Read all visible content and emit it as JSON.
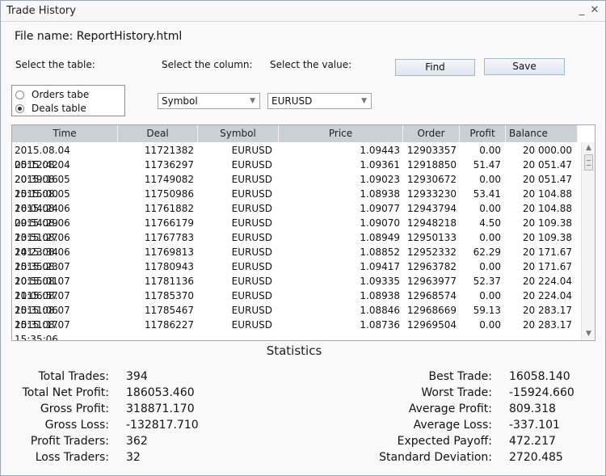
{
  "window": {
    "title": "Trade History"
  },
  "file": {
    "label": "File name: ReportHistory.html"
  },
  "labels": {
    "select_table": "Select the table:",
    "select_column": "Select the column:",
    "select_value": "Select the value:"
  },
  "buttons": {
    "find": "Find",
    "save": "Save"
  },
  "radio": {
    "orders": "Orders tabe",
    "deals": "Deals table",
    "selected": "deals"
  },
  "filters": {
    "column": "Symbol",
    "value": "EURUSD"
  },
  "table": {
    "headers": [
      "Time",
      "Deal",
      "Symbol",
      "Price",
      "Order",
      "Profit",
      "Balance"
    ],
    "rows": [
      [
        "2015.08.04 05:12:42",
        "11721382",
        "EURUSD",
        "1.09443",
        "12903357",
        "0.00",
        "20 000.00"
      ],
      [
        "2015.08.04 20:39:16",
        "11736297",
        "EURUSD",
        "1.09361",
        "12918850",
        "51.47",
        "20 051.47"
      ],
      [
        "2015.08.05 15:15:00",
        "11749082",
        "EURUSD",
        "1.09023",
        "12930672",
        "0.00",
        "20 051.47"
      ],
      [
        "2015.08.05 16:04:24",
        "11750986",
        "EURUSD",
        "1.08938",
        "12933230",
        "53.41",
        "20 104.88"
      ],
      [
        "2015.08.06 09:54:29",
        "11761882",
        "EURUSD",
        "1.09077",
        "12943794",
        "0.00",
        "20 104.88"
      ],
      [
        "2015.08.06 13:51:27",
        "11766179",
        "EURUSD",
        "1.09070",
        "12948218",
        "4.50",
        "20 109.38"
      ],
      [
        "2015.08.06 14:23:34",
        "11767783",
        "EURUSD",
        "1.08949",
        "12950133",
        "0.00",
        "20 109.38"
      ],
      [
        "2015.08.06 15:35:23",
        "11769813",
        "EURUSD",
        "1.08852",
        "12952332",
        "62.29",
        "20 171.67"
      ],
      [
        "2015.08.07 10:55:01",
        "11780943",
        "EURUSD",
        "1.09417",
        "12963782",
        "0.00",
        "20 171.67"
      ],
      [
        "2015.08.07 11:06:57",
        "11781136",
        "EURUSD",
        "1.09335",
        "12963977",
        "52.37",
        "20 224.04"
      ],
      [
        "2015.08.07 15:31:06",
        "11785370",
        "EURUSD",
        "1.08938",
        "12968574",
        "0.00",
        "20 224.04"
      ],
      [
        "2015.08.07 15:31:17",
        "11785467",
        "EURUSD",
        "1.08846",
        "12968669",
        "59.13",
        "20 283.17"
      ],
      [
        "2015.08.07 15:35:06",
        "11786227",
        "EURUSD",
        "1.08736",
        "12969504",
        "0.00",
        "20 283.17"
      ]
    ]
  },
  "statistics": {
    "title": "Statistics",
    "left": [
      {
        "label": "Total Trades:",
        "value": "394"
      },
      {
        "label": "Total Net Profit:",
        "value": "186053.460"
      },
      {
        "label": "Gross Profit:",
        "value": "318871.170"
      },
      {
        "label": "Gross Loss:",
        "value": "-132817.710"
      },
      {
        "label": "Profit Traders:",
        "value": "362"
      },
      {
        "label": "Loss Traders:",
        "value": "32"
      }
    ],
    "right": [
      {
        "label": "Best Trade:",
        "value": "16058.140"
      },
      {
        "label": "Worst Trade:",
        "value": "-15924.660"
      },
      {
        "label": "Average Profit:",
        "value": "809.318"
      },
      {
        "label": "Average Loss:",
        "value": "-337.101"
      },
      {
        "label": "Expected Payoff:",
        "value": "472.217"
      },
      {
        "label": "Standard Deviation:",
        "value": "2720.485"
      }
    ]
  },
  "icons": {
    "minimize": "minimize-icon",
    "close": "close-icon",
    "dropdown": "chevron-down-icon",
    "scroll_up": "arrow-up-icon",
    "scroll_down": "arrow-down-icon"
  }
}
